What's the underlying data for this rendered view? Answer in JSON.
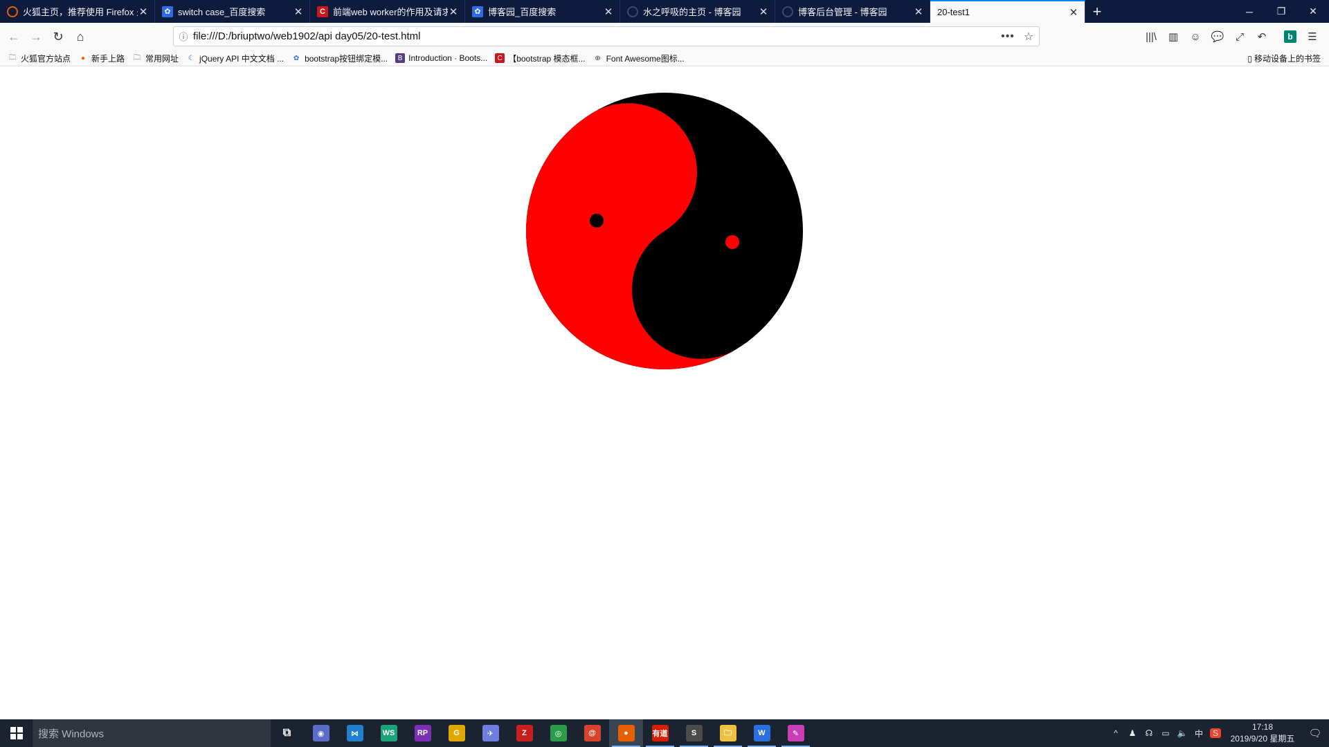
{
  "browser": {
    "tabs": [
      {
        "title": "火狐主页，推荐使用 Firefox 火",
        "icon": "firefox-icon",
        "favicon_color": "#e66000",
        "favicon_text": ""
      },
      {
        "title": "switch case_百度搜索",
        "icon": "baidu-paw-icon",
        "favicon_color": "#2e6be6",
        "favicon_text": "✿"
      },
      {
        "title": "前端web worker的作用及请求",
        "icon": "csdn-icon",
        "favicon_color": "#c9171e",
        "favicon_text": "C"
      },
      {
        "title": "博客园_百度搜索",
        "icon": "baidu-paw-icon",
        "favicon_color": "#2e6be6",
        "favicon_text": "✿"
      },
      {
        "title": "水之呼吸的主页 - 博客园",
        "icon": "cnblogs-icon",
        "favicon_color": "#0f1b3d",
        "favicon_text": ""
      },
      {
        "title": "博客后台管理 - 博客园",
        "icon": "cnblogs-icon",
        "favicon_color": "#0f1b3d",
        "favicon_text": ""
      },
      {
        "title": "20-test1",
        "icon": "",
        "favicon_color": "",
        "favicon_text": ""
      }
    ],
    "active_tab_index": 6,
    "new_tab_symbol": "+",
    "window_controls": {
      "minimize": "─",
      "restore": "❐",
      "close": "✕"
    },
    "nav": {
      "back": "←",
      "forward": "→",
      "reload": "↻",
      "home": "⌂"
    },
    "url": "file:///D:/briuptwo/web1902/api day05/20-test.html",
    "url_info_icon": "ⓘ",
    "page_actions": "•••",
    "bookmark_star": "☆",
    "toolbar_icons": [
      "library-icon",
      "sidebar-icon",
      "account-icon",
      "chat-icon",
      "screenshot-icon",
      "undo-icon",
      "bing-icon",
      "menu-icon"
    ],
    "toolbar_glyphs": [
      "|||\\",
      "▥",
      "☺",
      "💬",
      "⤢",
      "↶",
      "b",
      "☰"
    ],
    "bookmarks": [
      {
        "label": "火狐官方站点",
        "icon": "folder-icon",
        "glyph": "🗀",
        "color": "#666"
      },
      {
        "label": "新手上路",
        "icon": "firefox-icon",
        "glyph": "●",
        "color": "#e66000"
      },
      {
        "label": "常用网址",
        "icon": "folder-icon",
        "glyph": "🗀",
        "color": "#666"
      },
      {
        "label": "jQuery API 中文文档 ...",
        "icon": "jquery-icon",
        "glyph": "☾",
        "color": "#1d6fb5"
      },
      {
        "label": "bootstrap按钮绑定模...",
        "icon": "baidu-paw-icon",
        "glyph": "✿",
        "color": "#2e6be6"
      },
      {
        "label": "Introduction · Boots...",
        "icon": "bootstrap-icon",
        "glyph": "B",
        "color": "#563d7c"
      },
      {
        "label": "【bootstrap 模态框...",
        "icon": "csdn-icon",
        "glyph": "C",
        "color": "#c9171e"
      },
      {
        "label": "Font Awesome图标...",
        "icon": "globe-icon",
        "glyph": "⊕",
        "color": "#444"
      }
    ],
    "mobile_bookmarks": "移动设备上的书签"
  },
  "page": {
    "yinyang": {
      "primary_color": "#ff0000",
      "secondary_color": "#000000"
    }
  },
  "taskbar": {
    "search_placeholder": "搜索 Windows",
    "apps": [
      {
        "name": "task-view-icon",
        "glyph": "⧉",
        "color": "transparent"
      },
      {
        "name": "app-orb-icon",
        "glyph": "◉",
        "color": "#5a6cc8"
      },
      {
        "name": "vscode-icon",
        "glyph": "⋈",
        "color": "#1f7fd1"
      },
      {
        "name": "webstorm-icon",
        "glyph": "WS",
        "color": "#1aa37a"
      },
      {
        "name": "axure-rp-icon",
        "glyph": "RP",
        "color": "#7a2fb5"
      },
      {
        "name": "g-app-icon",
        "glyph": "G",
        "color": "#e0a800"
      },
      {
        "name": "feather-app-icon",
        "glyph": "✈",
        "color": "#6c7fe0"
      },
      {
        "name": "filezilla-icon",
        "glyph": "Z",
        "color": "#c91e1e"
      },
      {
        "name": "chrome-icon",
        "glyph": "◎",
        "color": "#2d9c4a"
      },
      {
        "name": "snail-app-icon",
        "glyph": "@",
        "color": "#d9432b"
      },
      {
        "name": "firefox-icon",
        "glyph": "●",
        "color": "#e66000"
      },
      {
        "name": "youdao-icon",
        "glyph": "有道",
        "color": "#d81e06"
      },
      {
        "name": "sublime-icon",
        "glyph": "S",
        "color": "#4b4b4b"
      },
      {
        "name": "file-explorer-icon",
        "glyph": "🗀",
        "color": "#f0c040"
      },
      {
        "name": "w-app-icon",
        "glyph": "W",
        "color": "#2a6fe0"
      },
      {
        "name": "pen-app-icon",
        "glyph": "✎",
        "color": "#c83cb4"
      }
    ],
    "tray_glyphs": [
      "^",
      "♟",
      "☊",
      "▭",
      "🔈",
      "中",
      "S"
    ],
    "time": "17:18",
    "date": "2019/9/20 星期五",
    "notifications_glyph": "🗨"
  }
}
